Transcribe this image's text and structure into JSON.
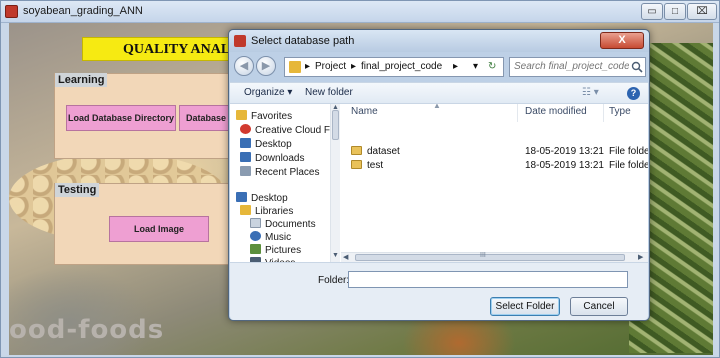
{
  "app": {
    "title": "soyabean_grading_ANN",
    "banner_title": "QUALITY ANALY",
    "watermark": "ood-foods",
    "window_buttons": [
      "▭",
      "□",
      "⌧"
    ]
  },
  "learning_panel": {
    "title": "Learning",
    "load_db_button": "Load Database Directory",
    "db_features_button": "Database Fe"
  },
  "testing_panel": {
    "title": "Testing",
    "load_image_button": "Load Image"
  },
  "dialog": {
    "title": "Select database path",
    "close_label": "X",
    "breadcrumb": [
      "Project",
      "final_project_code"
    ],
    "search_placeholder": "Search final_project_code",
    "toolbar": {
      "organize": "Organize ▾",
      "new_folder": "New folder"
    },
    "nav_items": [
      {
        "label": "Favorites",
        "icon": "star-icon",
        "color": "#e6b73a"
      },
      {
        "label": "Creative Cloud Fi",
        "icon": "creative-cloud-icon",
        "color": "#d23a2f"
      },
      {
        "label": "Desktop",
        "icon": "desktop-icon",
        "color": "#3a6fb5"
      },
      {
        "label": "Downloads",
        "icon": "downloads-icon",
        "color": "#3a6fb5"
      },
      {
        "label": "Recent Places",
        "icon": "recent-places-icon",
        "color": "#8a9bb0"
      },
      {
        "label": "Desktop",
        "icon": "desktop-icon",
        "color": "#3a6fb5"
      },
      {
        "label": "Libraries",
        "icon": "libraries-icon",
        "color": "#e6b73a"
      },
      {
        "label": "Documents",
        "icon": "documents-icon",
        "color": "#c9d3df"
      },
      {
        "label": "Music",
        "icon": "music-icon",
        "color": "#3a6fb5"
      },
      {
        "label": "Pictures",
        "icon": "pictures-icon",
        "color": "#5c8f3c"
      },
      {
        "label": "Videos",
        "icon": "videos-icon",
        "color": "#4b5d73"
      }
    ],
    "columns": {
      "name": "Name",
      "date": "Date modified",
      "type": "Type"
    },
    "files": [
      {
        "name": "dataset",
        "date": "18-05-2019 13:21",
        "type": "File folder"
      },
      {
        "name": "test",
        "date": "18-05-2019 13:21",
        "type": "File folder"
      }
    ],
    "scroll_glyph": "III",
    "folder_label": "Folder:",
    "folder_value": "",
    "select_button": "Select Folder",
    "cancel_button": "Cancel"
  }
}
